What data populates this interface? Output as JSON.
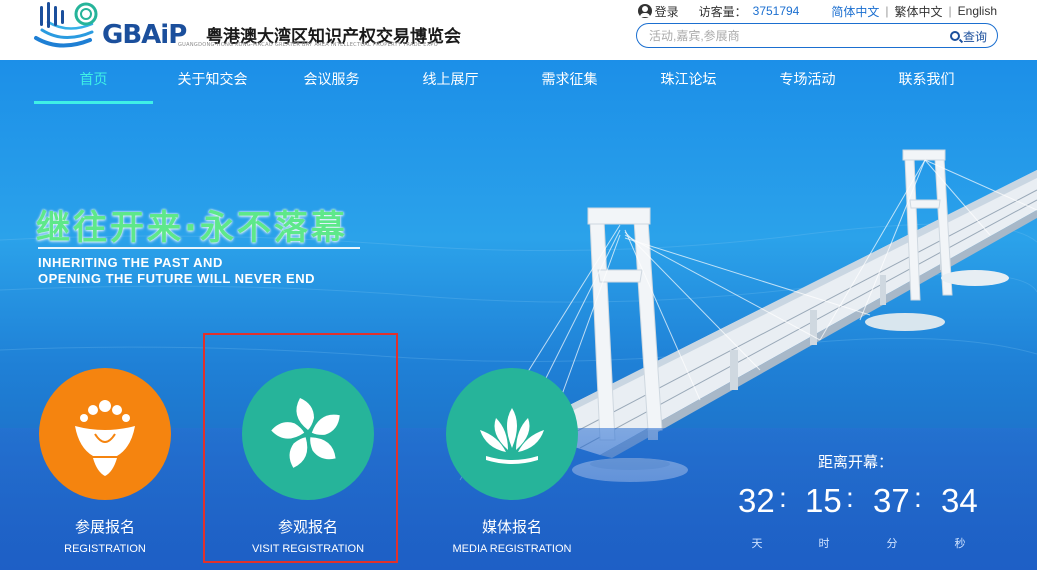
{
  "header": {
    "logo_text": "GBAiP",
    "logo_title": "粤港澳大湾区知识产权交易博览会",
    "logo_subtitle": "GUANGDONG-HONG KONG-MACAO GREATER BAY AREA INTELLECTUAL PROPERTY TRADE EXPO",
    "login_label": "登录",
    "visitor_label": "访客量：",
    "visitor_count": "3751794",
    "lang_simplified": "简体中文",
    "lang_traditional": "繁体中文",
    "lang_english": "English",
    "lang_sep": "|",
    "search_placeholder": "活动,嘉宾,参展商",
    "search_button": "查询"
  },
  "nav": {
    "items": [
      "首页",
      "关于知交会",
      "会议服务",
      "线上展厅",
      "需求征集",
      "珠江论坛",
      "专场活动",
      "联系我们"
    ],
    "active_index": 0
  },
  "hero": {
    "slogan_cn": "继往开来·永不落幕",
    "slogan_en_line1": "INHERITING THE PAST AND",
    "slogan_en_line2": "OPENING THE FUTURE WILL NEVER END"
  },
  "registrations": [
    {
      "title": "参展报名",
      "subtitle": "REGISTRATION",
      "icon": "flower-icon",
      "color": "#f5840f"
    },
    {
      "title": "参观报名",
      "subtitle": "VISIT REGISTRATION",
      "icon": "bauhinia-icon",
      "color": "#26b49a"
    },
    {
      "title": "媒体报名",
      "subtitle": "MEDIA REGISTRATION",
      "icon": "lotus-icon",
      "color": "#26b49a"
    }
  ],
  "countdown": {
    "title": "距离开幕：",
    "days": "32",
    "hours": "15",
    "minutes": "37",
    "seconds": "34",
    "sep": ":",
    "unit_days": "天",
    "unit_hours": "时",
    "unit_minutes": "分",
    "unit_seconds": "秒"
  },
  "colors": {
    "accent": "#1b6fd0",
    "nav_active": "#3ff0e6",
    "slogan": "#5ee88a",
    "highlight_border": "#e0312c"
  }
}
